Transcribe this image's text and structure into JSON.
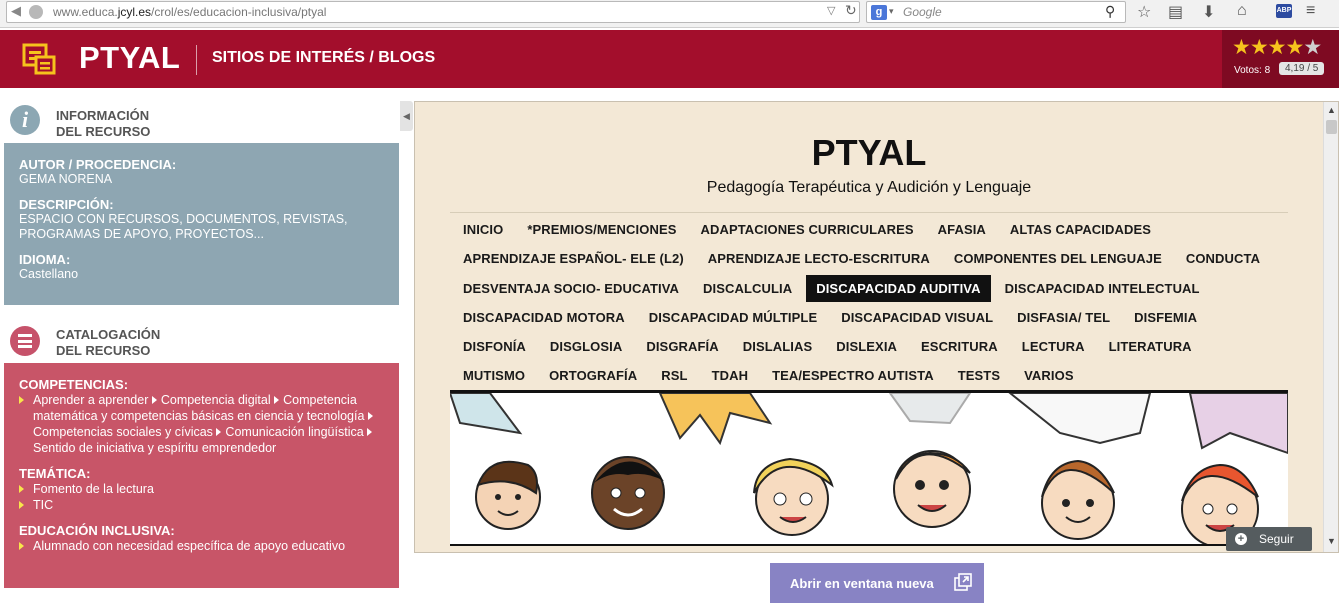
{
  "browser": {
    "url_prefix": "www.educa.",
    "url_domain": "jcyl.es",
    "url_path": "/crol/es/educacion-inclusiva/ptyal",
    "search_engine": "g",
    "search_placeholder": "Google",
    "abp_label": "ABP"
  },
  "header": {
    "title": "PTYAL",
    "subtitle": "SITIOS DE INTERÉS / BLOGS",
    "rating": {
      "stars_full": "★★★★",
      "stars_empty": "★",
      "votes_label": "Votos: 8",
      "score": "4,19 / 5",
      "value": 4.19,
      "max": 5
    }
  },
  "info_panel": {
    "title_line1": "INFORMACIÓN",
    "title_line2": "DEL RECURSO",
    "author_label": "AUTOR / PROCEDENCIA:",
    "author_value": "GEMA NORENA",
    "description_label": "DESCRIPCIÓN:",
    "description_value": "ESPACIO CON RECURSOS, DOCUMENTOS, REVISTAS, PROGRAMAS DE APOYO, PROYECTOS...",
    "language_label": "IDIOMA:",
    "language_value": "Castellano"
  },
  "catalog_panel": {
    "title_line1": "CATALOGACIÓN",
    "title_line2": "DEL RECURSO",
    "competencias_label": "COMPETENCIAS:",
    "competencias": [
      "Aprender a aprender",
      "Competencia digital",
      "Competencia matemática y competencias básicas en ciencia y tecnología",
      "Competencias sociales y cívicas",
      "Comunicación lingüística",
      "Sentido de iniciativa y espíritu emprendedor"
    ],
    "tematica_label": "TEMÁTICA:",
    "tematica": [
      "Fomento de la lectura",
      "TIC"
    ],
    "inclusiva_label": "EDUCACIÓN INCLUSIVA:",
    "inclusiva": [
      "Alumnado con necesidad específica de apoyo educativo"
    ]
  },
  "embedded": {
    "title": "PTYAL",
    "subtitle": "Pedagogía Terapéutica y Audición y Lenguaje",
    "menu_rows": [
      [
        "INICIO",
        "*PREMIOS/MENCIONES",
        "ADAPTACIONES CURRICULARES",
        "AFASIA",
        "ALTAS CAPACIDADES"
      ],
      [
        "APRENDIZAJE ESPAÑOL- ELE (L2)",
        "APRENDIZAJE LECTO-ESCRITURA",
        "COMPONENTES DEL LENGUAJE",
        "CONDUCTA"
      ],
      [
        "DESVENTAJA SOCIO- EDUCATIVA",
        "DISCALCULIA",
        "DISCAPACIDAD AUDITIVA",
        "DISCAPACIDAD INTELECTUAL"
      ],
      [
        "DISCAPACIDAD MOTORA",
        "DISCAPACIDAD MÚLTIPLE",
        "DISCAPACIDAD VISUAL",
        "DISFASIA/ TEL",
        "DISFEMIA"
      ],
      [
        "DISFONÍA",
        "DISGLOSIA",
        "DISGRAFÍA",
        "DISLALIAS",
        "DISLEXIA",
        "ESCRITURA",
        "LECTURA",
        "LITERATURA"
      ],
      [
        "MUTISMO",
        "ORTOGRAFÍA",
        "RSL",
        "TDAH",
        "TEA/ESPECTRO AUTISTA",
        "TESTS",
        "VARIOS"
      ]
    ],
    "active_item": "DISCAPACIDAD AUDITIVA",
    "follow_label": "Seguir"
  },
  "open_button": {
    "label": "Abrir en ventana nueva"
  },
  "colors": {
    "header_red": "#a30e2c",
    "info_blue": "#8ea6b2",
    "catalog_pink": "#c85568",
    "button_purple": "#8883c4",
    "embedded_bg": "#f3e8d6"
  }
}
